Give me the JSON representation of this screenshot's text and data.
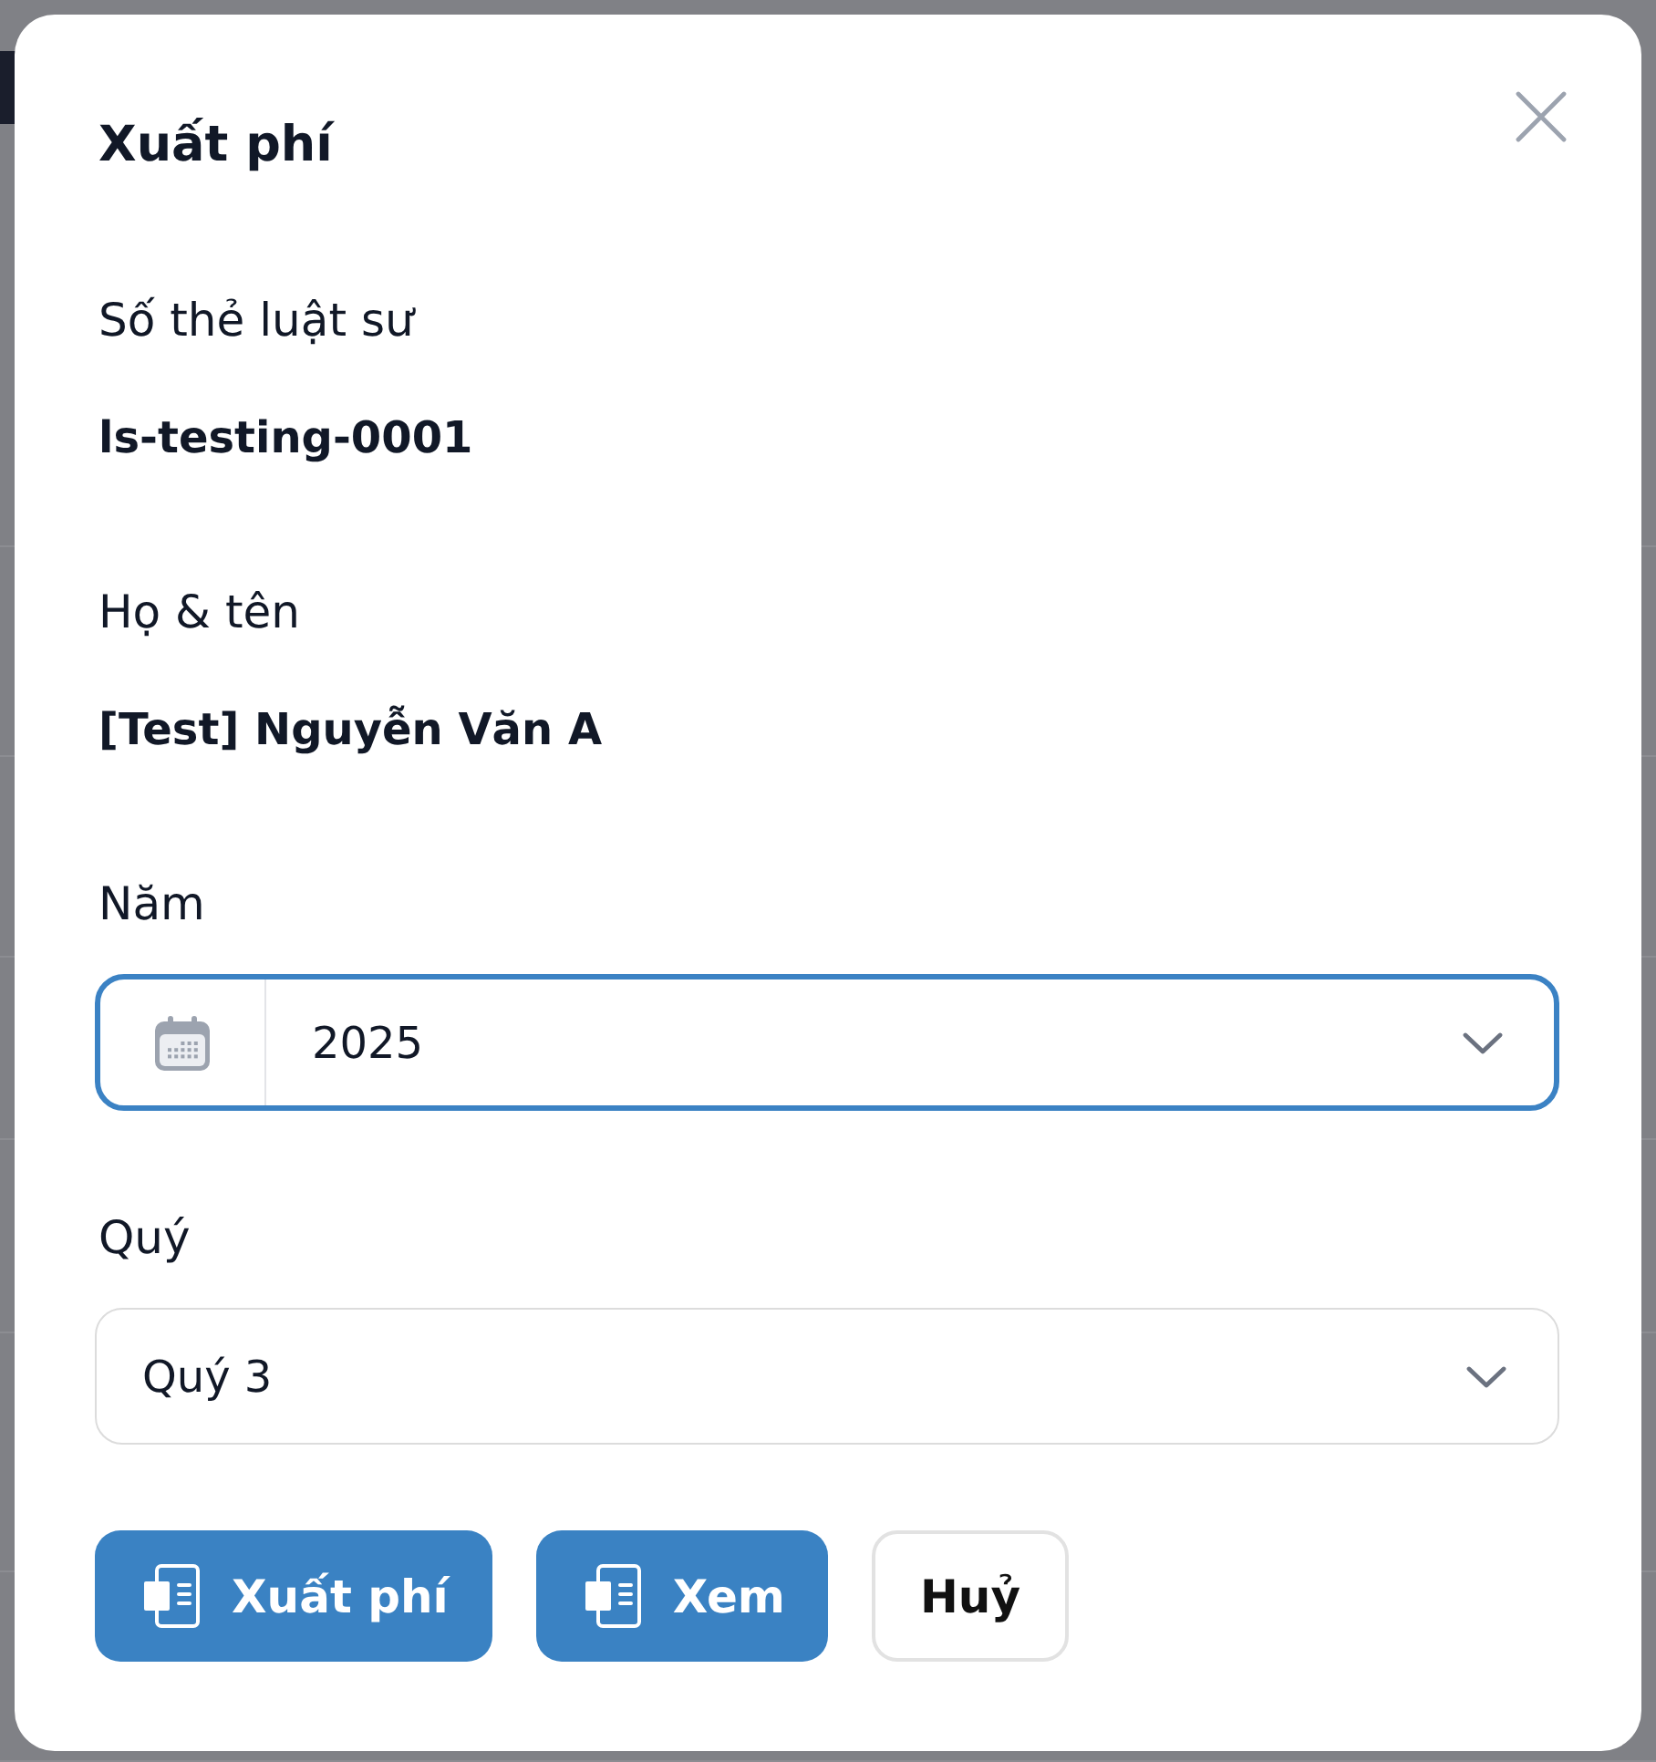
{
  "dialog": {
    "title": "Xuất phí",
    "fields": [
      {
        "kind": "text",
        "label": "Số thẻ luật sư",
        "value": "ls-testing-0001"
      },
      {
        "kind": "text",
        "label": "Họ & tên",
        "value": "[Test] Nguyễn Văn A"
      },
      {
        "kind": "date_select",
        "label": "Năm",
        "value": "2025",
        "focused": true
      },
      {
        "kind": "select",
        "label": "Quý",
        "value": "Quý 3",
        "focused": false
      }
    ],
    "buttons": [
      {
        "kind": "primary",
        "label": "Xuất phí"
      },
      {
        "kind": "primary",
        "label": "Xem"
      },
      {
        "kind": "secondary",
        "label": "Huỷ"
      }
    ]
  }
}
